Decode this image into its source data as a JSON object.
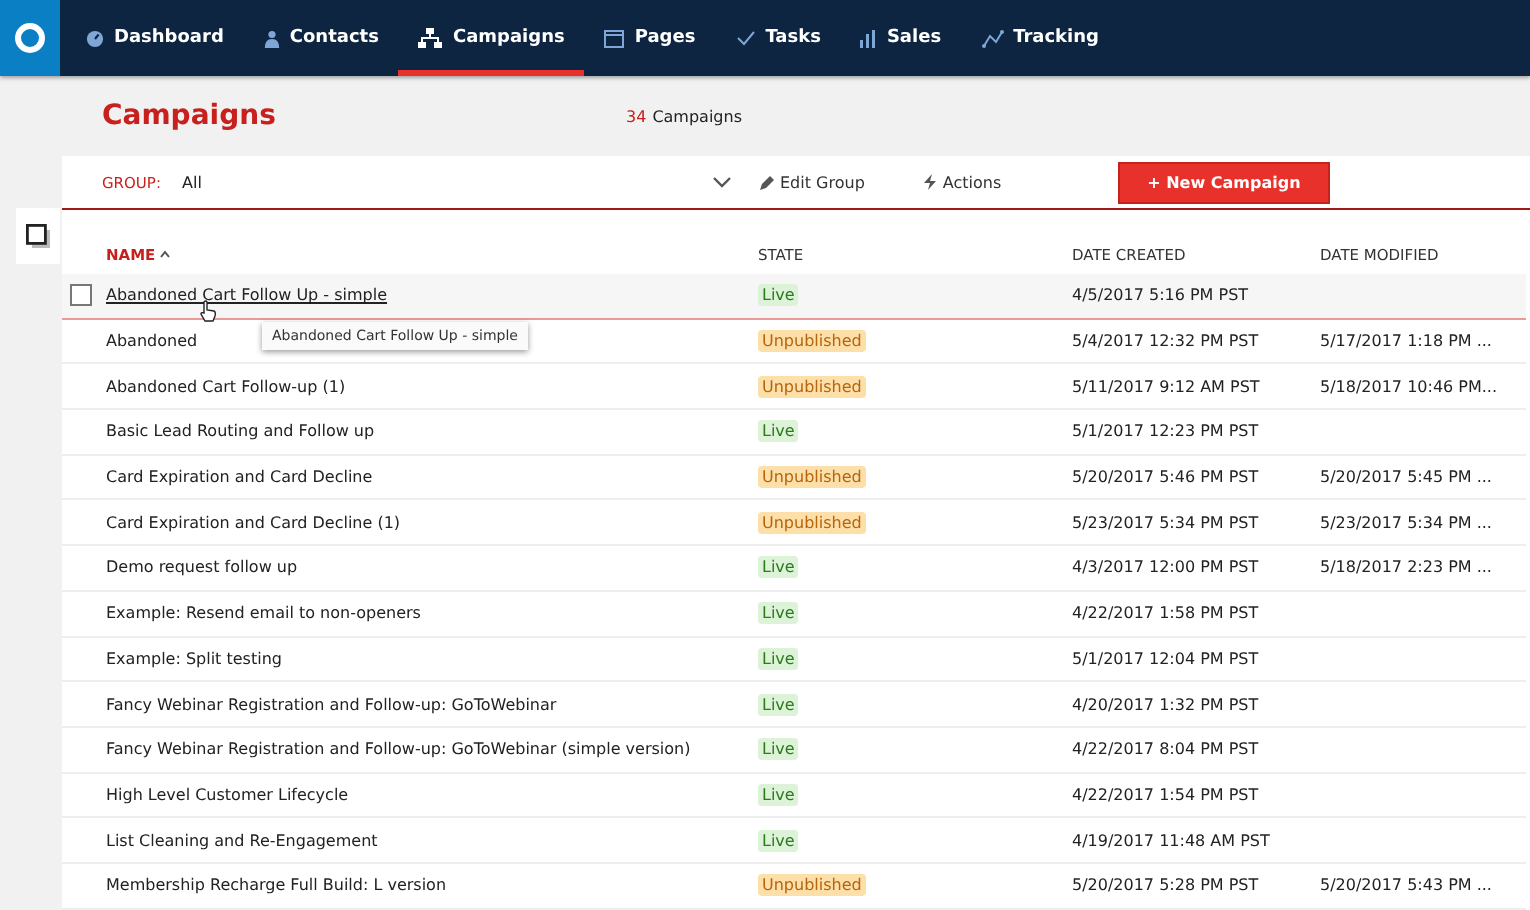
{
  "nav": [
    {
      "label": "Dashboard",
      "selected": false
    },
    {
      "label": "Contacts",
      "selected": false
    },
    {
      "label": "Campaigns",
      "selected": true
    },
    {
      "label": "Pages",
      "selected": false
    },
    {
      "label": "Tasks",
      "selected": false
    },
    {
      "label": "Sales",
      "selected": false
    },
    {
      "label": "Tracking",
      "selected": false
    }
  ],
  "page": {
    "title": "Campaigns",
    "count": "34",
    "count_label": "Campaigns"
  },
  "toolbar": {
    "group_label": "GROUP:",
    "group_value": "All",
    "edit_group": "Edit Group",
    "actions": "Actions",
    "new_campaign": "+ New Campaign"
  },
  "table": {
    "columns": [
      {
        "label": "NAME",
        "sorted": true
      },
      {
        "label": "STATE",
        "sorted": false
      },
      {
        "label": "DATE CREATED",
        "sorted": false
      },
      {
        "label": "DATE MODIFIED",
        "sorted": false
      }
    ],
    "rows": [
      {
        "name": "Abandoned Cart Follow Up - simple",
        "state": "Live",
        "kind": "live",
        "created": "4/5/2017 5:16 PM PST",
        "modified": "",
        "hovered": true
      },
      {
        "name": "Abandoned",
        "state": "Unpublished",
        "kind": "unpublished",
        "created": "5/4/2017 12:32 PM PST",
        "modified": "5/17/2017 1:18 PM ...",
        "hovered": false
      },
      {
        "name": "Abandoned Cart Follow-up (1)",
        "state": "Unpublished",
        "kind": "unpublished",
        "created": "5/11/2017 9:12 AM PST",
        "modified": "5/18/2017 10:46 PM...",
        "hovered": false
      },
      {
        "name": "Basic Lead Routing and Follow up",
        "state": "Live",
        "kind": "live",
        "created": "5/1/2017 12:23 PM PST",
        "modified": "",
        "hovered": false
      },
      {
        "name": "Card Expiration and Card Decline",
        "state": "Unpublished",
        "kind": "unpublished",
        "created": "5/20/2017 5:46 PM PST",
        "modified": "5/20/2017 5:45 PM ...",
        "hovered": false
      },
      {
        "name": "Card Expiration and Card Decline (1)",
        "state": "Unpublished",
        "kind": "unpublished",
        "created": "5/23/2017 5:34 PM PST",
        "modified": "5/23/2017 5:34 PM ...",
        "hovered": false
      },
      {
        "name": "Demo request follow up",
        "state": "Live",
        "kind": "live",
        "created": "4/3/2017 12:00 PM PST",
        "modified": "5/18/2017 2:23 PM ...",
        "hovered": false
      },
      {
        "name": "Example: Resend email to non-openers",
        "state": "Live",
        "kind": "live",
        "created": "4/22/2017 1:58 PM PST",
        "modified": "",
        "hovered": false
      },
      {
        "name": "Example: Split testing",
        "state": "Live",
        "kind": "live",
        "created": "5/1/2017 12:04 PM PST",
        "modified": "",
        "hovered": false
      },
      {
        "name": "Fancy Webinar Registration and Follow-up: GoToWebinar",
        "state": "Live",
        "kind": "live",
        "created": "4/20/2017 1:32 PM PST",
        "modified": "",
        "hovered": false
      },
      {
        "name": "Fancy Webinar Registration and Follow-up: GoToWebinar (simple version)",
        "state": "Live",
        "kind": "live",
        "created": "4/22/2017 8:04 PM PST",
        "modified": "",
        "hovered": false
      },
      {
        "name": "High Level Customer Lifecycle",
        "state": "Live",
        "kind": "live",
        "created": "4/22/2017 1:54 PM PST",
        "modified": "",
        "hovered": false
      },
      {
        "name": "List Cleaning and Re-Engagement",
        "state": "Live",
        "kind": "live",
        "created": "4/19/2017 11:48 AM PST",
        "modified": "",
        "hovered": false
      },
      {
        "name": "Membership Recharge Full Build: L version",
        "state": "Unpublished",
        "kind": "unpublished",
        "created": "5/20/2017 5:28 PM PST",
        "modified": "5/20/2017 5:43 PM ...",
        "hovered": false
      }
    ]
  },
  "tooltip": {
    "text": "Abandoned Cart Follow Up - simple"
  }
}
